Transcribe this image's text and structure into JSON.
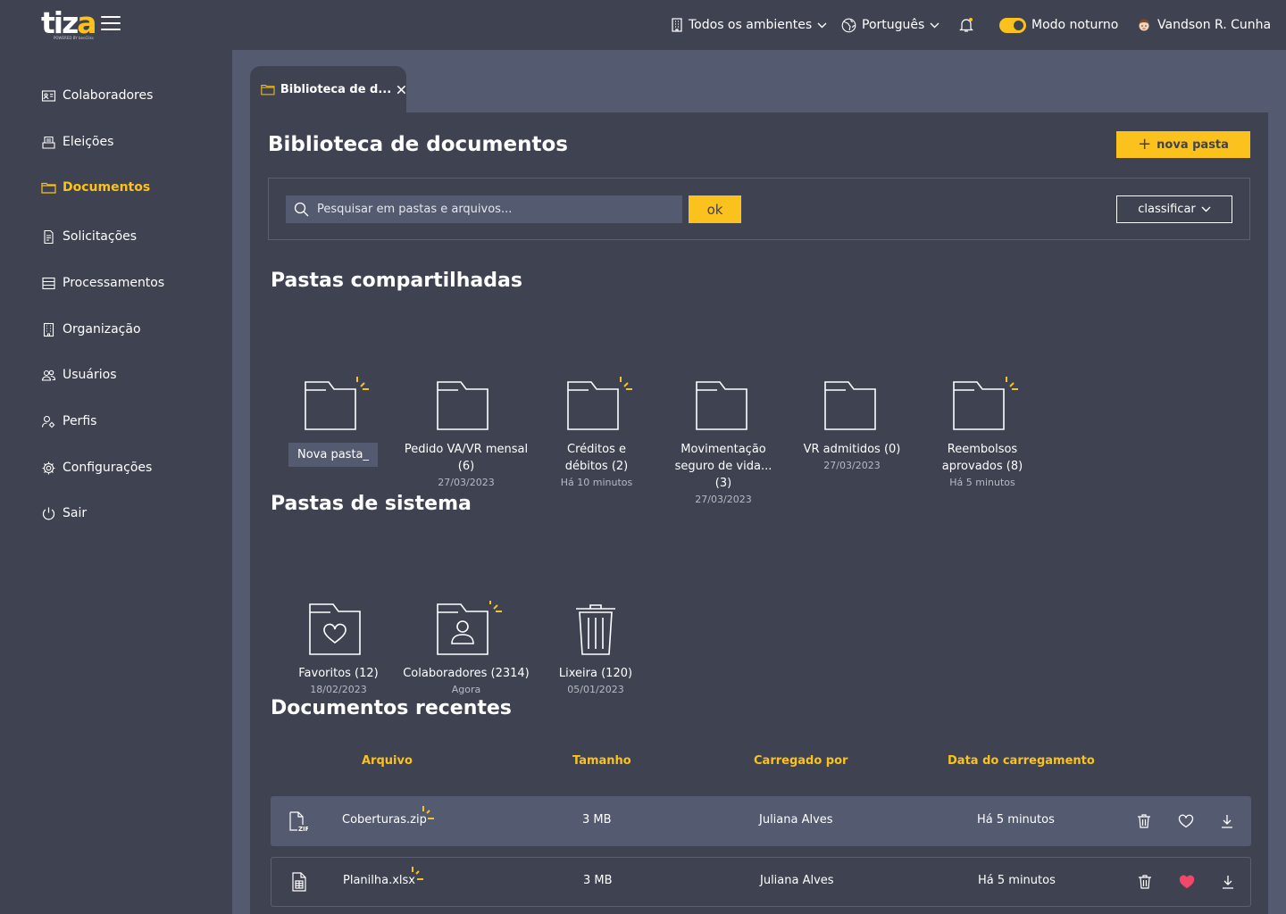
{
  "brand": {
    "logo_main": "tiz",
    "logo_accent": "a",
    "logo_sub": "POWERED BY benCliks"
  },
  "topbar": {
    "environment": "Todos os ambientes",
    "language": "Português",
    "dark_mode_label": "Modo noturno",
    "dark_mode_on": true,
    "user_name": "Vandson R. Cunha"
  },
  "sidebar": {
    "items": [
      {
        "label": "Colaboradores",
        "icon": "id-card-icon"
      },
      {
        "label": "Eleições",
        "icon": "ballot-box-icon"
      },
      {
        "label": "Documentos",
        "icon": "folder-icon",
        "active": true
      },
      {
        "label": "Solicitações",
        "icon": "document-icon"
      },
      {
        "label": "Processamentos",
        "icon": "list-icon"
      },
      {
        "label": "Organização",
        "icon": "building-icon"
      },
      {
        "label": "Usuários",
        "icon": "users-icon"
      },
      {
        "label": "Perfis",
        "icon": "profile-settings-icon"
      },
      {
        "label": "Configurações",
        "icon": "gear-icon"
      },
      {
        "label": "Sair",
        "icon": "power-icon"
      }
    ]
  },
  "tab": {
    "label": "Biblioteca de d..."
  },
  "page": {
    "title": "Biblioteca de documentos",
    "new_folder_label": "nova pasta",
    "search_placeholder": "Pesquisar em pastas e arquivos...",
    "ok_label": "ok",
    "sort_label": "classificar"
  },
  "shared": {
    "title": "Pastas compartilhadas",
    "folders": [
      {
        "name": "Nova pasta_",
        "date": "",
        "is_new": true,
        "editing": true
      },
      {
        "name": "Pedido VA/VR mensal (6)",
        "date": "27/03/2023",
        "is_new": false
      },
      {
        "name": "Créditos e débitos (2)",
        "date": "Há 10 minutos",
        "is_new": true
      },
      {
        "name": "Movimentação seguro de vida... (3)",
        "date": "27/03/2023",
        "is_new": false
      },
      {
        "name": "VR admitidos (0)",
        "date": "27/03/2023",
        "is_new": false
      },
      {
        "name": "Reembolsos aprovados (8)",
        "date": "Há 5 minutos",
        "is_new": true
      }
    ]
  },
  "system": {
    "title": "Pastas de sistema",
    "folders": [
      {
        "name": "Favoritos (12)",
        "date": "18/02/2023",
        "icon": "heart-folder-icon"
      },
      {
        "name": "Colaboradores (2314)",
        "date": "Agora",
        "icon": "person-folder-icon",
        "is_new": true
      },
      {
        "name": "Lixeira (120)",
        "date": "05/01/2023",
        "icon": "trash-icon"
      }
    ]
  },
  "recent": {
    "title": "Documentos recentes",
    "columns": [
      "Arquivo",
      "Tamanho",
      "Carregado por",
      "Data do carregamento"
    ],
    "rows": [
      {
        "file": "Coberturas.zip",
        "size": "3 MB",
        "uploaded_by": "Juliana Alves",
        "date": "Há 5 minutos",
        "favorite": false,
        "icon": "zip-file-icon"
      },
      {
        "file": "Planilha.xlsx",
        "size": "3 MB",
        "uploaded_by": "Juliana Alves",
        "date": "Há 5 minutos",
        "favorite": true,
        "icon": "spreadsheet-file-icon"
      }
    ]
  },
  "colors": {
    "accent": "#fbc21d",
    "background": "#3f4351",
    "surface": "#545a6f",
    "favorite": "#f2466b"
  }
}
